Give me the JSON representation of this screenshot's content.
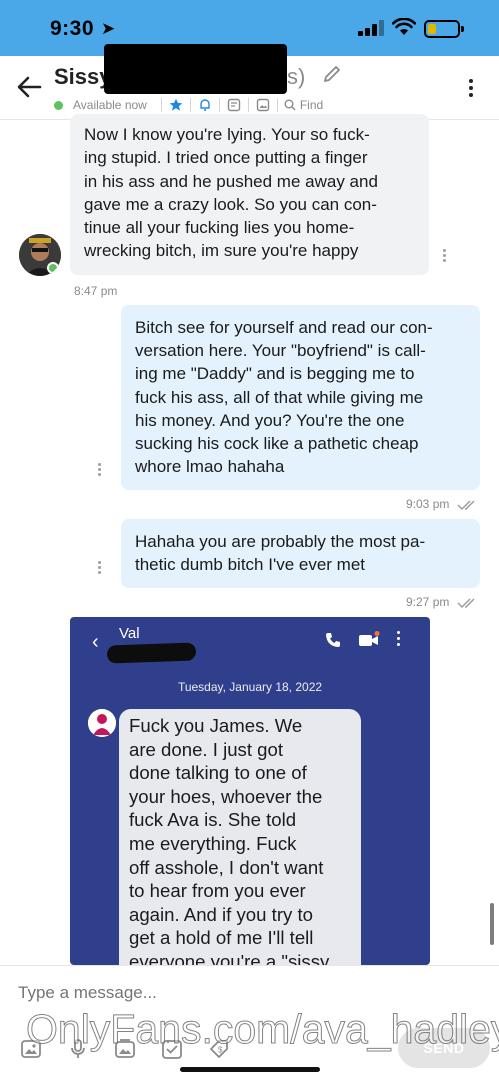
{
  "status_bar": {
    "time": "9:30",
    "location_glyph": "➤"
  },
  "header": {
    "title": "Sissy",
    "title_tail": "s)",
    "availability": "Available now",
    "find_label": "Find"
  },
  "messages": [
    {
      "direction": "incoming",
      "lines": [
        "Now I know you're lying. Your so fuck-",
        "ing stupid. I tried once putting a finger",
        "in his ass and he pushed me away and",
        "gave me a crazy look. So you can con-",
        "tinue all your fucking lies you home-",
        "wrecking bitch, im sure you're happy"
      ],
      "time": "8:47 pm"
    },
    {
      "direction": "outgoing",
      "lines": [
        "Bitch see for yourself and read our con-",
        "versation here. Your \"boyfriend\" is call-",
        "ing me \"Daddy\" and is begging me to",
        "fuck his ass, all of that while giving me",
        "his money. And you? You're the one",
        "sucking his cock like a pathetic cheap",
        "whore lmao hahaha"
      ],
      "time": "9:03 pm"
    },
    {
      "direction": "outgoing",
      "lines": [
        "Hahaha you are probably the most pa-",
        "thetic dumb bitch I've ever met"
      ],
      "time": "9:27 pm"
    }
  ],
  "embedded_screenshot": {
    "contact_name": "Val",
    "date": "Tuesday, January 18, 2022",
    "message_lines": [
      "Fuck you James.  We",
      "are done. I just got",
      "done talking to one of",
      "your hoes, whoever the",
      "fuck Ava is. She told",
      "me everything.  Fuck",
      "off asshole, I don't want",
      "to hear from you ever",
      "again. And if you try to",
      "get a hold of me I'll tell",
      "everyone you're a \"sissy"
    ]
  },
  "composer": {
    "placeholder": "Type a message...",
    "send_label": "SEND"
  },
  "watermark": "OnlyFans.com/ava_hadley",
  "colors": {
    "status_bar": "#4aa8e8",
    "accent": "#1e88e5",
    "incoming_bubble": "#f0f2f4",
    "outgoing_bubble": "#e3f2fd",
    "online": "#5cc25c",
    "embed_background": "#303f8b"
  },
  "icons": {
    "back": "arrow-left-icon",
    "edit": "pencil-icon",
    "menu": "kebab-vertical-icon",
    "favorite": "star-icon",
    "notifications": "bell-icon",
    "notes": "note-icon",
    "media": "image-icon",
    "search": "search-icon",
    "composer_tools": [
      "image-icon",
      "microphone-icon",
      "media-icon",
      "poll-icon",
      "price-tag-icon"
    ]
  }
}
